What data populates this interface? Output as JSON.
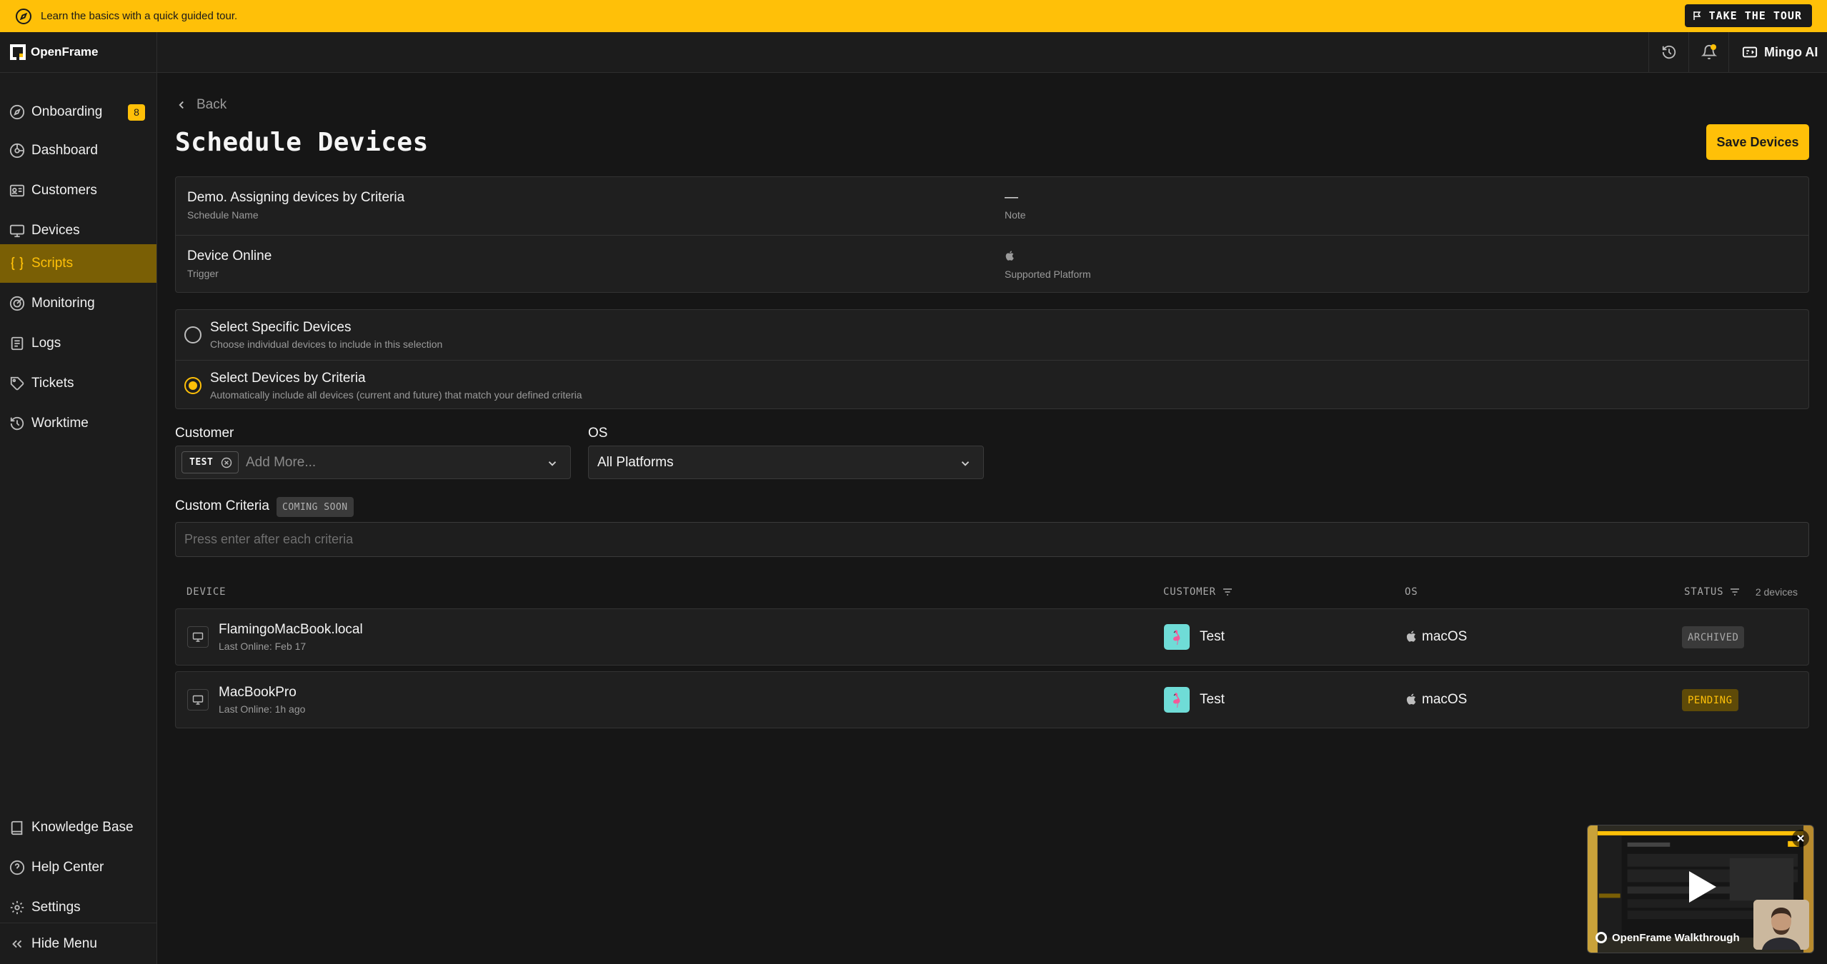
{
  "banner": {
    "text": "Learn the basics with a quick guided tour.",
    "tour_button": "TAKE THE TOUR",
    "color": "#ffc008"
  },
  "app": {
    "name": "OpenFrame"
  },
  "sidebar": {
    "items": [
      {
        "label": "Onboarding",
        "icon": "compass-icon",
        "badge": "8"
      },
      {
        "label": "Dashboard",
        "icon": "dashboard-icon"
      },
      {
        "label": "Customers",
        "icon": "id-card-icon"
      },
      {
        "label": "Devices",
        "icon": "monitor-icon"
      },
      {
        "label": "Scripts",
        "icon": "braces-icon",
        "active": true
      },
      {
        "label": "Monitoring",
        "icon": "target-icon"
      },
      {
        "label": "Logs",
        "icon": "clipboard-icon"
      },
      {
        "label": "Tickets",
        "icon": "tag-icon"
      },
      {
        "label": "Worktime",
        "icon": "history-icon"
      }
    ],
    "bottom_items": [
      {
        "label": "Knowledge Base",
        "icon": "book-icon"
      },
      {
        "label": "Help Center",
        "icon": "help-icon"
      },
      {
        "label": "Settings",
        "icon": "gear-icon"
      }
    ],
    "hide_menu": "Hide Menu"
  },
  "topbar": {
    "assistant_label": "Mingo AI"
  },
  "page": {
    "back_label": "Back",
    "title": "Schedule Devices",
    "save_button": "Save Devices"
  },
  "schedule_info": {
    "name_value": "Demo. Assigning devices by Criteria",
    "name_label": "Schedule Name",
    "note_value": "—",
    "note_label": "Note",
    "trigger_value": "Device Online",
    "trigger_label": "Trigger",
    "platform_icon": "apple-icon",
    "platform_label": "Supported Platform"
  },
  "selection_mode": {
    "options": [
      {
        "title": "Select Specific Devices",
        "description": "Choose individual devices to include in this selection",
        "checked": false
      },
      {
        "title": "Select Devices by Criteria",
        "description": "Automatically include all devices (current and future) that match your defined criteria",
        "checked": true
      }
    ]
  },
  "filters": {
    "customer_label": "Customer",
    "customer_chip": "TEST",
    "customer_placeholder": "Add More...",
    "os_label": "OS",
    "os_value": "All Platforms",
    "custom_criteria_label": "Custom Criteria",
    "coming_soon": "COMING SOON",
    "criteria_placeholder": "Press enter after each criteria"
  },
  "table": {
    "headers": {
      "device": "DEVICE",
      "customer": "CUSTOMER",
      "os": "OS",
      "status": "STATUS"
    },
    "count": "2 devices",
    "rows": [
      {
        "name": "FlamingoMacBook.local",
        "last_online": "Last Online: Feb 17",
        "customer": "Test",
        "os": "macOS",
        "status": "ARCHIVED"
      },
      {
        "name": "MacBookPro",
        "last_online": "Last Online: 1h ago",
        "customer": "Test",
        "os": "macOS",
        "status": "PENDING"
      }
    ]
  },
  "video": {
    "title": "OpenFrame Walkthrough"
  }
}
